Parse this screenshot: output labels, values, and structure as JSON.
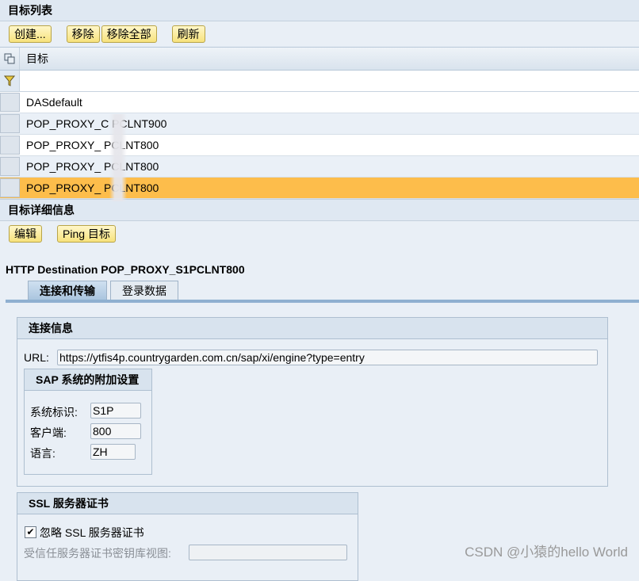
{
  "list_section": {
    "title": "目标列表"
  },
  "list_toolbar": {
    "create": "创建...",
    "remove": "移除",
    "remove_all": "移除全部",
    "refresh": "刷新"
  },
  "table": {
    "column": "目标",
    "rows": [
      "DASdefault",
      "POP_PROXY_C    PCLNT900",
      "POP_PROXY_    PCLNT800",
      "POP_PROXY_    PCLNT800",
      "POP_PROXY_    PCLNT800"
    ],
    "selected_index": 4
  },
  "detail_section": {
    "title": "目标详细信息"
  },
  "detail_toolbar": {
    "edit": "编辑",
    "ping": "Ping 目标"
  },
  "destination_title": "HTTP Destination POP_PROXY_S1PCLNT800",
  "tabs": [
    "连接和传输",
    "登录数据"
  ],
  "connection": {
    "title": "连接信息",
    "url_label": "URL:",
    "url_value": "https://ytfis4p.countrygarden.com.cn/sap/xi/engine?type=entry"
  },
  "sap_settings": {
    "title": "SAP 系统的附加设置",
    "system_id_label": "系统标识:",
    "system_id": "S1P",
    "client_label": "客户端:",
    "client": "800",
    "language_label": "语言:",
    "language": "ZH"
  },
  "ssl": {
    "title": "SSL 服务器证书",
    "ignore_label": "忽略 SSL 服务器证书",
    "ignore_checked": true,
    "keystore_label": "受信任服务器证书密钥库视图:",
    "keystore_value": ""
  },
  "watermark": "CSDN @小猿的hello World"
}
